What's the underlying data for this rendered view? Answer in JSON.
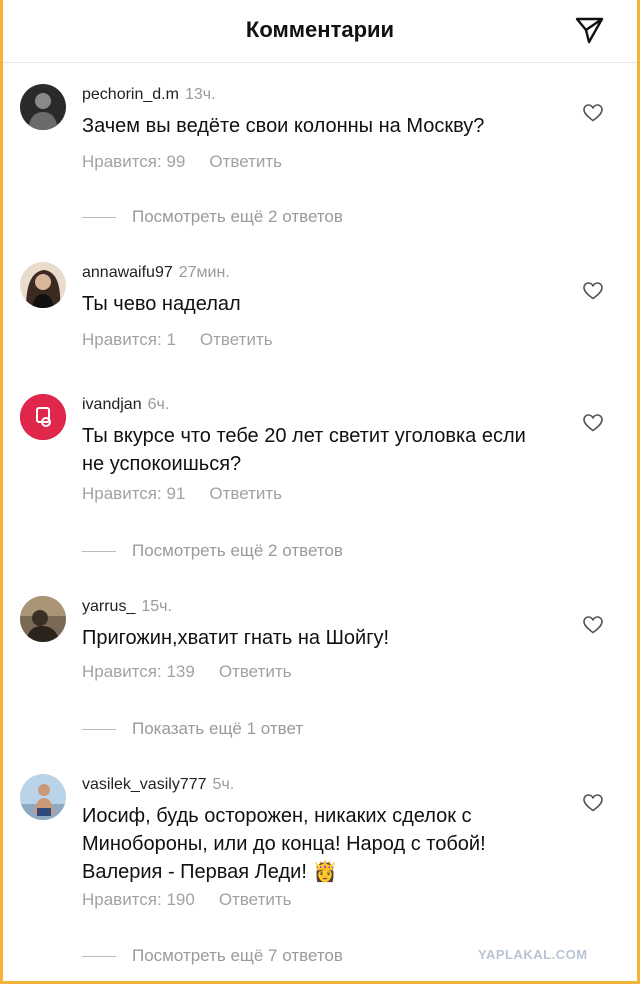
{
  "header": {
    "title": "Комментарии"
  },
  "comments": [
    {
      "username": "pechorin_d.m",
      "time": "13ч.",
      "text": "Зачем вы ведёте свои колонны на Москву?",
      "likes": "Нравится: 99",
      "reply": "Ответить",
      "more": "Посмотреть ещё 2 ответов"
    },
    {
      "username": "annawaifu97",
      "time": "27мин.",
      "text": "Ты чево наделал",
      "likes": "Нравится: 1",
      "reply": "Ответить"
    },
    {
      "username": "ivandjan",
      "time": "6ч.",
      "text": "Ты вкурсе что тебе 20 лет светит уголовка если не успокоишься?",
      "likes": "Нравится: 91",
      "reply": "Ответить",
      "more": "Посмотреть ещё 2 ответов"
    },
    {
      "username": "yarrus_",
      "time": "15ч.",
      "text": "Пригожин,хватит гнать на Шойгу!",
      "likes": "Нравится: 139",
      "reply": "Ответить",
      "more": "Показать ещё 1 ответ"
    },
    {
      "username": "vasilek_vasily777",
      "time": "5ч.",
      "text": "Иосиф, будь осторожен, никаких сделок с Минобороны, или до конца! Народ с тобой! Валерия - Первая Леди! 👸",
      "likes": "Нравится: 190",
      "reply": "Ответить",
      "more": "Посмотреть ещё 7 ответов"
    }
  ],
  "watermark": "YAPLAKAL.COM",
  "colors": {
    "border": "#f2b43a",
    "muted": "#9a9a9a",
    "ivandjan_avatar": "#e0264a"
  },
  "icons": {
    "header": "send-icon",
    "comment_action": "heart-icon"
  }
}
